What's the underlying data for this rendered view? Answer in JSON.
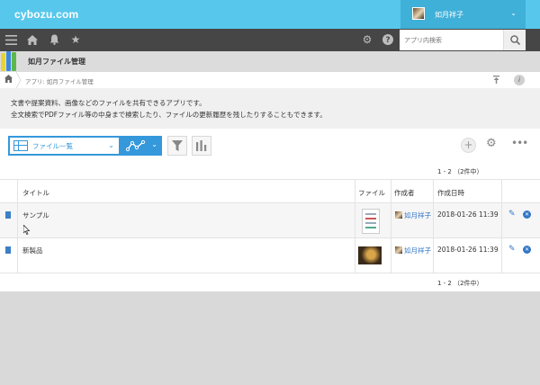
{
  "header": {
    "logo": "cybozu.com",
    "user_name": "如月祥子"
  },
  "toolbar": {
    "icons": [
      "menu-icon",
      "home-icon",
      "bell-icon",
      "star-icon",
      "gear-icon",
      "help-icon"
    ],
    "search_placeholder": "アプリ内検索"
  },
  "app": {
    "title": "如月ファイル管理",
    "breadcrumb": "アプリ: 如月ファイル管理",
    "description": [
      "文書や提案資料、画像などのファイルを共有できるアプリです。",
      "全文検索でPDFファイル等の中身まで検索したり、ファイルの更新履歴を残したりすることもできます。"
    ]
  },
  "view": {
    "selected": "ファイル一覧"
  },
  "pager": {
    "top": "1 - 2 （2件中）",
    "bottom": "1 - 2 （2件中）"
  },
  "table": {
    "headers": [
      "タイトル",
      "ファイル",
      "作成者",
      "作成日時"
    ],
    "rows": [
      {
        "title": "サンプル",
        "creator": "如月祥子",
        "created": "2018-01-26 11:39"
      },
      {
        "title": "新製品",
        "creator": "如月祥子",
        "created": "2018-01-26 11:39"
      }
    ]
  },
  "colors": {
    "header_bg": "#57c8ec",
    "toolbar_bg": "#464646",
    "accent": "#3498db",
    "link": "#3476c6"
  }
}
